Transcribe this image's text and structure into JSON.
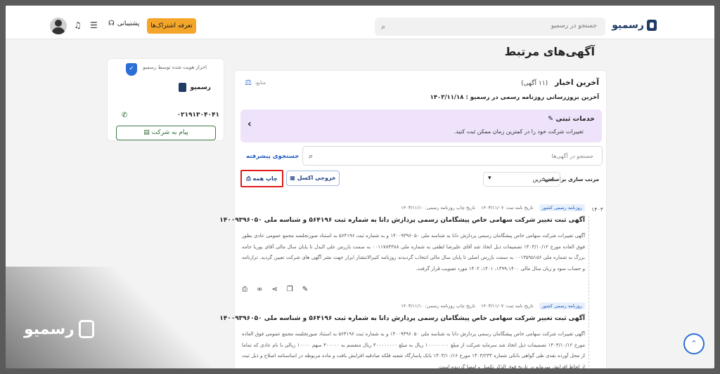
{
  "header": {
    "logo_text": "رسمیو",
    "search_placeholder": "جستجو در رسمیو",
    "plans_button": "تعرفه اشتراک‌ها",
    "support_label": "پشتیبانی"
  },
  "page_title": "آگهی‌های مرتبط",
  "company": {
    "verified_text": "احراز هویت شده توسط رسمیو",
    "name": "رسمیو",
    "phone": "۰۲۱۹۱۳۰۴۰۴۱",
    "message_button": "پیام به شرکت"
  },
  "feed": {
    "title": "آخرین اخبار",
    "count": "(۱۱ آگهی)",
    "sources_label": "منابع:",
    "last_update": "آخرین بروزرسانی روزنامه رسمی در رسمیو : ۱۴۰۳/۱۱/۱۸",
    "banner_title": "خدمات ثبتی",
    "banner_subtitle": "تغییرات شرکت خود را در کمترین زمان ممکن ثبت کنید.",
    "advanced_search": "جستجوی پیشرفته",
    "search_placeholder": "جستجو در آگهی‌ها",
    "sort_label": "مرتب سازی براساس:",
    "sort_value": "جدیدترین",
    "excel_button": "خروجی اکسل",
    "print_all_button": "چاپ همه",
    "year": "۱۴۰۳"
  },
  "ads": [
    {
      "source": "روزنامه رسمی کشور",
      "letter_date": "تاریخ نامه ثبت: ۱۴۰۳/۱۱/۰۷",
      "print_date": "تاریخ چاپ روزنامه رسمی: ۱۴۰۳/۱۱/۱۰",
      "title": "آگهی ثبت تغییر شرکت سهامی خاص پیشگامان رسمی پردازش دانا به شماره ثبت ۵۶۴۱۹۶ و شناسه ملی ۱۴۰۰۹۳۹۶۰۵۰",
      "body": "آگهی تغییرات شرکت سهامی خاص پیشگامان رسمی پردازش دانا به شناسه ملی ۱۴۰۰۹۳۹۶۰۵۰ و به شماره ثبت ۵۶۴۱۹۶ به استناد صورتجلسه مجمع عمومی عادی بطور فوق العاده مورخ ۱۴۰۳/۱۰/۱۲ تصمیمات ذیل اتخاذ شد آقای علیرضا لطفی به شماره ملی ۰۰۱۱۷۸۴۳۸۸ به سمت بازرس علی البدل تا پایان سال مالی آقای یوریا جامه بزرگ به شماره ملی ۰۰۱۳۵۹۵۱۵۶ به سمت بازرس اصلی تا پایان سال مالی انتخاب گردیدند روزنامه کثیرالانتشار ابرار جهت نشر آگهی های شرکت تعیین گردید. ترازنامه و حساب سود و زیان سال مالی ۱۳۹۹،۱۴۰۰، ۱۴۰۱، ۱۴۰۲ مورد تصویب قرار گرفت."
    },
    {
      "source": "روزنامه رسمی کشور",
      "letter_date": "تاریخ نامه ثبت: ۱۴۰۳/۱۱/۰۷",
      "print_date": "تاریخ چاپ روزنامه رسمی: ۱۴۰۳/۱۱/۱۰",
      "title": "آگهی ثبت تغییر شرکت سهامی خاص پیشگامان رسمی پردازش دانا به شماره ثبت ۵۶۴۱۹۶ و شناسه ملی ۱۴۰۰۹۳۹۶۰۵۰",
      "body": "آگهی تغییرات شرکت سهامی خاص پیشگامان رسمی پردازش دانا به شناسه ملی ۱۴۰۰۹۳۹۶۰۵۰ و به شماره ثبت ۵۶۴۱۹۶ به استناد صورتجلسه مجمع عمومی فوق العاده مورخ ۱۴۰۳/۱۰/۱۲ تصمیمات ذیل اتخاذ شد سرمایه شرکت از مبلغ ۱۰۰۰۰۰۰۰۰ ریال به مبلغ ۳۰۰۰۰۰۰۰۰ ریال منقسم به ۳۰۰۰۰۰ سهم ۱۰۰۰۰ ریالی با نام عادی که تماما از محل آورده نقدی طی گواهی بانکی شماره ۱۴۰۳/۲۳۳ مورخ ۱۴۰۳/۱۰/۱۶ بانک پاسارگاد شعبه قلکه صادقیه افزایش یافت و ماده مربوطه در اساسنامه اصلاح و ذیل ثبت از لحاظ افزایش سرمایه در تاریخ فوق الذکر تکمیل و امضا گردیده است."
    }
  ],
  "watermark": "رسمیو"
}
